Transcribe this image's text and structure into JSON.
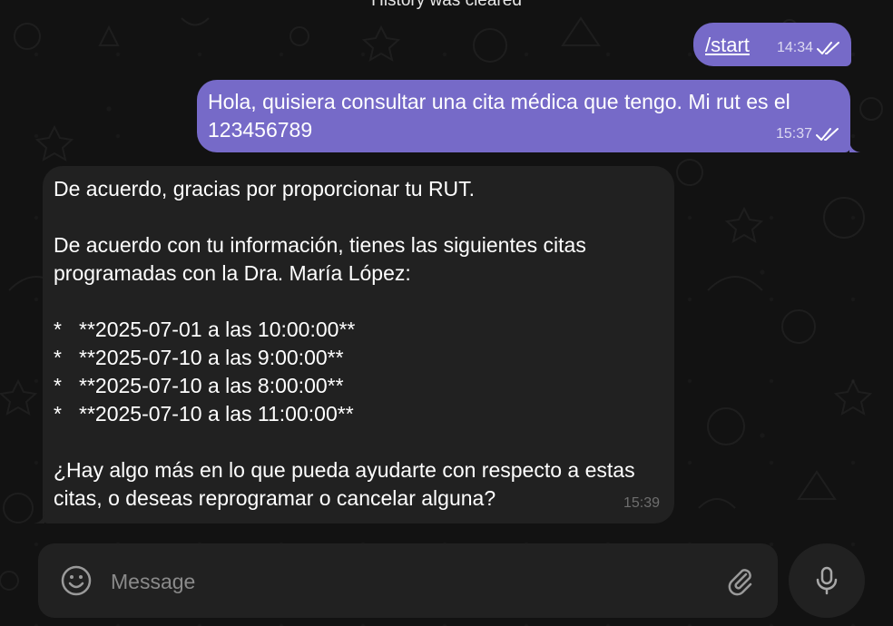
{
  "system_note": "History was cleared",
  "messages": {
    "start": {
      "text": "/start",
      "time": "14:34"
    },
    "hola": {
      "line1": "Hola, quisiera consultar una cita médica que tengo. Mi rut es el",
      "line2": "123456789",
      "time": "15:37"
    },
    "reply": {
      "p1": "De acuerdo, gracias por proporcionar tu RUT.",
      "p2_line1": "De acuerdo con tu información, tienes las siguientes citas",
      "p2_line2": "programadas con la Dra. María López:",
      "bullet": "*",
      "items": [
        "**2025-07-01 a las 10:00:00**",
        "**2025-07-10 a las 9:00:00**",
        "**2025-07-10 a las 8:00:00**",
        "**2025-07-10 a las 11:00:00**"
      ],
      "p3_line1": "¿Hay algo más en lo que pueda ayudarte con respecto a estas",
      "p3_line2": "citas, o deseas reprogramar o cancelar alguna?",
      "time": "15:39"
    }
  },
  "composer": {
    "placeholder": "Message",
    "value": ""
  },
  "icons": {
    "emoji": "smile-icon",
    "attach": "paperclip-icon",
    "mic": "microphone-icon",
    "read": "double-check-icon"
  },
  "colors": {
    "outgoing_bubble": "#766ac8",
    "incoming_bubble": "#212121",
    "background": "#121212"
  }
}
